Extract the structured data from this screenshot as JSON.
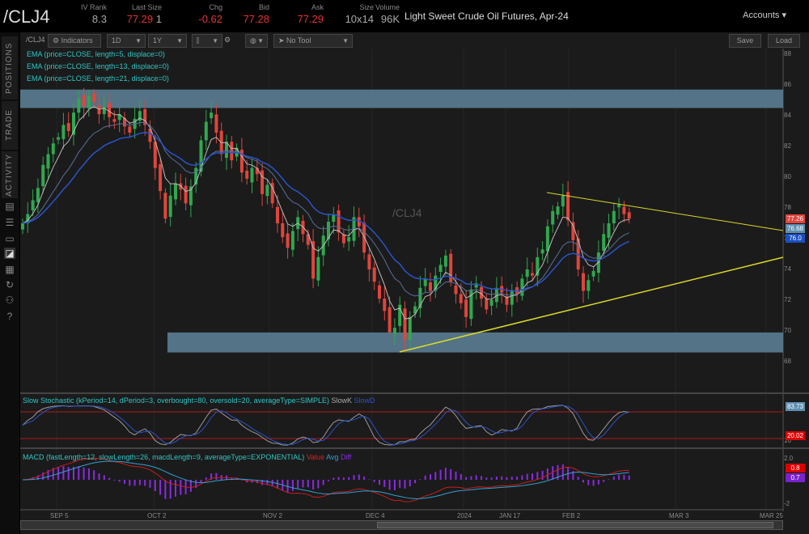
{
  "header": {
    "symbol": "/CLJ4",
    "quotes": [
      {
        "label": "IV Rank",
        "value": "8.3",
        "color": "#aaaaaa"
      },
      {
        "label": "Last Size",
        "value": "77.29",
        "extra": "1",
        "color": "#e33333"
      },
      {
        "label": "Chg",
        "value": "-0.62",
        "color": "#e33333"
      },
      {
        "label": "Bid",
        "value": "77.28",
        "color": "#e33333"
      },
      {
        "label": "Ask",
        "value": "77.29",
        "color": "#e33333"
      },
      {
        "label": "Size",
        "value": "10x14",
        "color": "#aaaaaa"
      },
      {
        "label": "Volume",
        "value": "96K",
        "color": "#aaaaaa"
      }
    ],
    "description": "Light Sweet Crude Oil Futures, Apr-24",
    "accounts": "Accounts"
  },
  "sidebar": {
    "tabs": [
      "POSITIONS",
      "TRADE",
      "ACTIVITY"
    ]
  },
  "toolbar": {
    "symbol": "/CLJ4",
    "indicators": "Indicators",
    "aggregation": "1D",
    "timeframe": "1Y",
    "tool": "No Tool",
    "save": "Save",
    "load": "Load"
  },
  "studies": {
    "ema": [
      "EMA (price=CLOSE, length=5, displace=0)",
      "EMA (price=CLOSE, length=13, displace=0)",
      "EMA (price=CLOSE, length=21, displace=0)"
    ],
    "stoch": "Slow Stochastic (kPeriod=14, dPeriod=3, overbought=80, oversold=20, averageType=SIMPLE)",
    "stoch_k": "SlowK",
    "stoch_d": "SlowD",
    "macd": "MACD (fastLength=12, slowLength=26, macdLength=9, averageType=EXPONENTIAL)",
    "macd_value": "Value",
    "macd_avg": "Avg",
    "macd_diff": "Diff"
  },
  "watermark": "/CLJ4",
  "price_tags": {
    "last": "77.26",
    "ema5": "76.68",
    "ema13": "76.0",
    "stoch": "83.73",
    "stoch_low": "20.02",
    "macd1": "0.8",
    "macd2": "0.7"
  },
  "chart_data": {
    "type": "candlestick",
    "ylim": [
      67,
      89
    ],
    "y_ticks": [
      "88",
      "86",
      "84",
      "82",
      "80",
      "78",
      "76",
      "74",
      "72",
      "70",
      "68"
    ],
    "x_ticks": [
      "SEP 5",
      "OCT 2",
      "NOV 2",
      "DEC 4",
      "2024",
      "JAN 17",
      "FEB 2",
      "MAR 3",
      "MAR 25"
    ],
    "stoch_ticks": [
      "10"
    ],
    "macd_ticks": [
      "2.0",
      "-2"
    ],
    "closes": [
      77.0,
      77.6,
      78.5,
      79.3,
      80.8,
      81.5,
      82.2,
      82.6,
      83.4,
      83.0,
      84.2,
      85.1,
      84.6,
      85.3,
      84.9,
      84.1,
      84.6,
      83.9,
      83.6,
      84.1,
      83.3,
      82.9,
      83.8,
      84.3,
      83.4,
      82.3,
      80.6,
      79.1,
      77.3,
      78.8,
      79.6,
      79.2,
      78.3,
      79.4,
      80.6,
      82.4,
      83.6,
      84.2,
      82.9,
      81.5,
      82.3,
      81.1,
      81.9,
      80.3,
      79.9,
      80.6,
      80.2,
      78.9,
      79.5,
      78.3,
      77.0,
      76.1,
      75.4,
      76.5,
      77.4,
      76.3,
      75.6,
      73.4,
      74.8,
      76.2,
      77.1,
      77.6,
      76.4,
      75.7,
      76.1,
      77.4,
      76.8,
      75.1,
      74.0,
      73.2,
      72.1,
      71.3,
      69.9,
      70.2,
      71.7,
      69.4,
      70.9,
      71.6,
      72.8,
      73.4,
      72.6,
      73.6,
      74.3,
      74.9,
      73.2,
      72.4,
      71.8,
      70.9,
      72.7,
      73.1,
      72.1,
      71.4,
      72.0,
      72.8,
      72.5,
      71.7,
      72.6,
      72.4,
      73.4,
      74.0,
      73.6,
      74.8,
      75.3,
      76.8,
      77.8,
      78.1,
      78.8,
      77.2,
      75.9,
      74.0,
      72.6,
      73.3,
      73.9,
      75.1,
      76.3,
      77.0,
      77.8,
      78.2,
      77.6,
      77.3
    ],
    "zones": [
      [
        84.5,
        85.7
      ],
      [
        68.6,
        69.9
      ]
    ],
    "colors": {
      "up": "#2fa84f",
      "down": "#e0453c",
      "ema5": "#bbbbbb",
      "ema13": "#5a6f9a",
      "ema21": "#2a54c8",
      "zone": "#5e8299",
      "trend": "#d9d92b"
    }
  }
}
